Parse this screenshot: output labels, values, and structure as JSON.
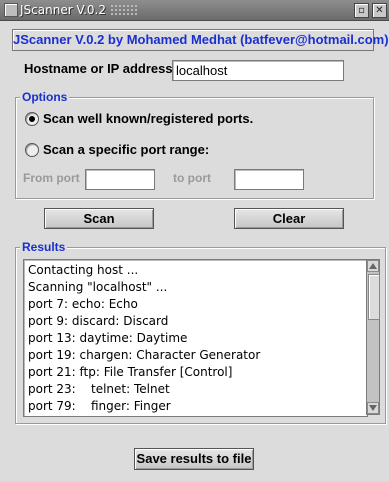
{
  "window": {
    "title": "JScanner V.0.2",
    "minimize_glyph": "▫",
    "close_glyph": "✕",
    "icon": "window-icon"
  },
  "banner": "JScanner  V.0.2 by Mohamed Medhat (batfever@hotmail.com)",
  "host": {
    "label": "Hostname or IP address:",
    "value": "localhost"
  },
  "options": {
    "title": "Options",
    "radio_known": "Scan well known/registered ports.",
    "radio_range": "Scan a specific port range:",
    "selected": "known",
    "from_label": "From port",
    "to_label": "to port",
    "from_value": "",
    "to_value": ""
  },
  "actions": {
    "scan_label": "Scan",
    "clear_label": "Clear"
  },
  "results": {
    "title": "Results",
    "lines": [
      "Contacting host ...",
      "Scanning \"localhost\" ...",
      "port 7: echo: Echo",
      "port 9: discard: Discard",
      "port 13: daytime: Daytime",
      "port 19: chargen: Character Generator",
      "port 21: ftp: File Transfer [Control]",
      "port 23:    telnet: Telnet",
      "port 79:    finger: Finger"
    ]
  },
  "save_label": "Save results to file",
  "colors": {
    "accent": "#1a2fd0",
    "background": "#dcdcdc",
    "titlebar": "#7a7a7a"
  }
}
